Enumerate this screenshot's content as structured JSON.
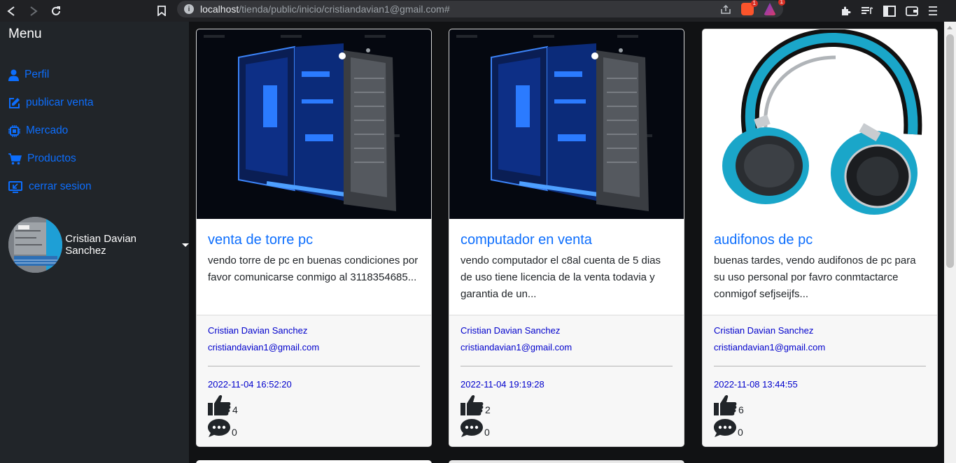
{
  "browser": {
    "url_host": "localhost",
    "url_path": "/tienda/public/inicio/cristiandavian1@gmail.com#",
    "brave_badge": "1",
    "alert_badge": "1"
  },
  "sidebar": {
    "title": "Menu",
    "items": [
      {
        "label": "Perfil",
        "icon": "user-icon"
      },
      {
        "label": "publicar venta",
        "icon": "edit-icon"
      },
      {
        "label": "Mercado",
        "icon": "chip-icon"
      },
      {
        "label": "Productos",
        "icon": "cart-icon"
      },
      {
        "label": "cerrar sesion",
        "icon": "logout-icon"
      }
    ],
    "user_name": "Cristian Davian Sanchez"
  },
  "cards": [
    {
      "title": "venta de torre pc",
      "text": "vendo torre de pc en buenas condiciones por favor comunicarse conmigo al 3118354685...",
      "author": "Cristian Davian Sanchez",
      "email": "cristiandavian1@gmail.com",
      "date": "2022-11-04 16:52:20",
      "likes": "4",
      "comments": "0"
    },
    {
      "title": "computador en venta",
      "text": "vendo computador el c8al cuenta de 5 dias de uso tiene licencia de la venta todavia y garantia de un...",
      "author": "Cristian Davian Sanchez",
      "email": "cristiandavian1@gmail.com",
      "date": "2022-11-04 19:19:28",
      "likes": "2",
      "comments": "0"
    },
    {
      "title": "audifonos de pc",
      "text": "buenas tardes, vendo audifonos de pc para su uso personal por favro conmtactarce conmigof sefjseijfs...",
      "author": "Cristian Davian Sanchez",
      "email": "cristiandavian1@gmail.com",
      "date": "2022-11-08 13:44:55",
      "likes": "6",
      "comments": "0"
    }
  ]
}
